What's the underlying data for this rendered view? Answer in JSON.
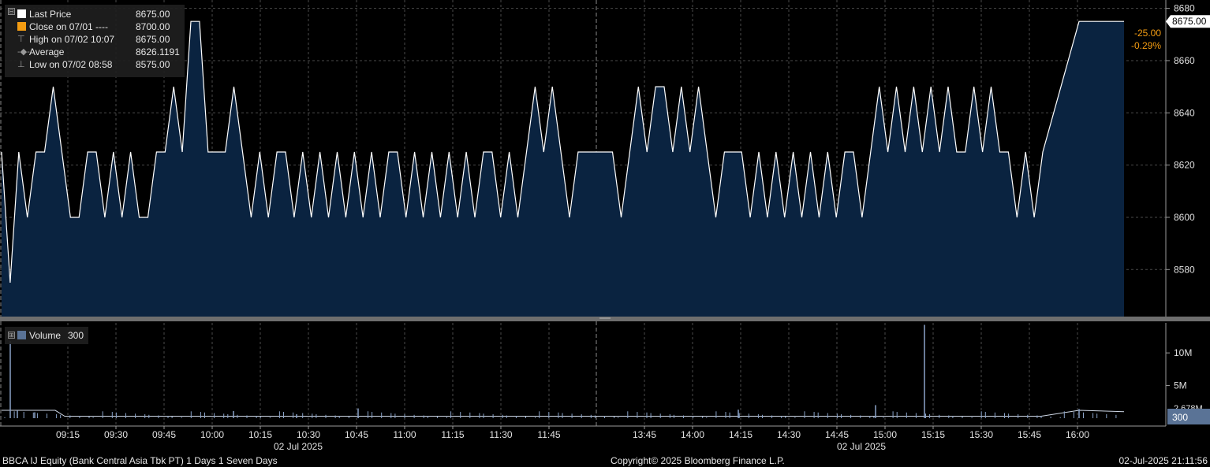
{
  "legend": {
    "rows": [
      {
        "label": "Last Price",
        "value": "8675.00",
        "swatch": "#ffffff",
        "kind": "box"
      },
      {
        "label": "Close on 07/01 ----",
        "value": "8700.00",
        "swatch": "#f39c12",
        "kind": "box"
      },
      {
        "label": "High on 07/02 10:07",
        "value": "8675.00",
        "swatch": "",
        "kind": "high-marker"
      },
      {
        "label": "Average",
        "value": "8626.1191",
        "swatch": "",
        "kind": "average-marker"
      },
      {
        "label": "Low on 07/02 08:58",
        "value": "8575.00",
        "swatch": "",
        "kind": "low-marker"
      }
    ],
    "volume": {
      "label": "Volume",
      "value": "300",
      "swatch": "#5a7396"
    }
  },
  "footer": {
    "left": "BBCA IJ Equity (Bank Central Asia Tbk PT) 1 Days 1 Seven Days",
    "center": "Copyright© 2025 Bloomberg Finance L.P.",
    "right": "02-Jul-2025 21:11:56"
  },
  "colors": {
    "background": "#000000",
    "price_fill": "#0a2340",
    "price_line": "#ffffff",
    "grid": "#4a4a4a",
    "change": "#f39c12",
    "volume_bar": "#8aa3c8",
    "last_tag_bg": "#ffffff",
    "volume_tag_bg": "#5a7396"
  },
  "chart_data": [
    {
      "type": "area",
      "series": [
        {
          "name": "Last Price",
          "y": [
            8625,
            8575,
            8625,
            8600,
            8625,
            8625,
            8650,
            8625,
            8600,
            8600,
            8625,
            8625,
            8600,
            8625,
            8600,
            8625,
            8600,
            8600,
            8625,
            8625,
            8650,
            8625,
            8675,
            8675,
            8625,
            8625,
            8625,
            8650,
            8625,
            8600,
            8625,
            8600,
            8625,
            8625,
            8600,
            8625,
            8600,
            8625,
            8600,
            8625,
            8600,
            8625,
            8600,
            8625,
            8600,
            8625,
            8625,
            8600,
            8625,
            8600,
            8625,
            8600,
            8625,
            8600,
            8625,
            8600,
            8625,
            8625,
            8600,
            8625,
            8600,
            8625,
            8650,
            8625,
            8650,
            8625,
            8600,
            8625,
            8625,
            8625,
            8625,
            8625,
            8600,
            8625,
            8650,
            8625,
            8650,
            8650,
            8625,
            8650,
            8625,
            8650,
            8625,
            8600,
            8625,
            8625,
            8625,
            8600,
            8625,
            8600,
            8625,
            8600,
            8625,
            8600,
            8625,
            8600,
            8625,
            8600,
            8625,
            8625,
            8600,
            8625,
            8650,
            8625,
            8650,
            8625,
            8650,
            8625,
            8650,
            8625,
            8650,
            8625,
            8625,
            8650,
            8625,
            8650,
            8625,
            8625,
            8600,
            8625,
            8600,
            8625,
            8675,
            8675
          ]
        }
      ],
      "x_start": "09:00",
      "x_end": "16:15",
      "x_ticks": [
        "09:15",
        "09:30",
        "09:45",
        "10:00",
        "10:15",
        "10:30",
        "10:45",
        "11:00",
        "11:15",
        "11:30",
        "11:45",
        "13:45",
        "14:00",
        "14:15",
        "14:30",
        "14:45",
        "15:00",
        "15:15",
        "15:30",
        "15:45",
        "16:00"
      ],
      "x_date_label": "02 Jul 2025",
      "y_ticks": [
        8580,
        8600,
        8620,
        8640,
        8660,
        8680
      ],
      "ylim": [
        8562,
        8682
      ],
      "last_value": "8675.00",
      "change": "-25.00",
      "change_pct": "-0.29%",
      "grid": true
    },
    {
      "type": "bar",
      "series": [
        {
          "name": "Volume",
          "spikes": [
            11800000,
            1200000,
            900000,
            1100000,
            600000,
            1500000,
            1300000,
            14300000,
            2000000,
            1400000
          ]
        }
      ],
      "baseline": 300,
      "y_ticks": [
        "5M",
        "10M"
      ],
      "ylim": [
        0,
        14600000
      ],
      "last_value": "300",
      "partial_tick_label": "2.678M"
    }
  ]
}
